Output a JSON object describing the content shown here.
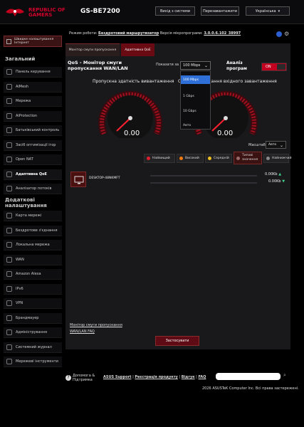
{
  "header": {
    "brand_line1": "REPUBLIC OF",
    "brand_line2": "GAMERS",
    "model": "GS-BE7200",
    "logout": "Вихід з системи",
    "reboot": "Перезавантажити",
    "language": "Українська"
  },
  "status": {
    "mode_label": "Режим роботи:",
    "mode_value": "Бездротовий маршрутизатор",
    "fw_label": "Версія мікропрограми:",
    "fw_value": "3.0.0.6.102_38997"
  },
  "sidebar": {
    "quick": "Швидке налаштування Інтернет",
    "general_title": "Загальний",
    "general_items": [
      {
        "label": "Панель керування",
        "icon": "dashboard-icon"
      },
      {
        "label": "AiMesh",
        "icon": "mesh-icon"
      },
      {
        "label": "Мережа",
        "icon": "network-icon"
      },
      {
        "label": "AiProtection",
        "icon": "shield-icon"
      },
      {
        "label": "Батьківський контроль",
        "icon": "parental-icon"
      },
      {
        "label": "Засіб оптимізації ігор",
        "icon": "gamepad-icon"
      },
      {
        "label": "Open NAT",
        "icon": "nat-icon"
      },
      {
        "label": "Адаптивна QoE",
        "icon": "qos-icon"
      },
      {
        "label": "Аналізатор потоків",
        "icon": "analyzer-icon"
      }
    ],
    "advanced_title": "Додаткові налаштування",
    "advanced_items": [
      {
        "label": "Карта мережі",
        "icon": "map-icon"
      },
      {
        "label": "Бездротове з'єднання",
        "icon": "wifi-icon"
      },
      {
        "label": "Локальна мережа",
        "icon": "lan-icon"
      },
      {
        "label": "WAN",
        "icon": "globe-icon"
      },
      {
        "label": "Amazon Alexa",
        "icon": "alexa-icon"
      },
      {
        "label": "IPv6",
        "icon": "ipv6-icon"
      },
      {
        "label": "VPN",
        "icon": "vpn-icon"
      },
      {
        "label": "Брандмауер",
        "icon": "firewall-icon"
      },
      {
        "label": "Адміністрування",
        "icon": "admin-icon"
      },
      {
        "label": "Системний журнал",
        "icon": "log-icon"
      },
      {
        "label": "Мережеві інструменти",
        "icon": "tools-icon"
      }
    ]
  },
  "main": {
    "tab1": "Монітор смуги пропускання",
    "tab2": "Адаптивна QoE",
    "title": "QoS - Монітор смуги пропускання WAN/LAN",
    "show_label": "Показати за",
    "show_value": "100 Mbps",
    "dropdown": [
      "100 Mbps",
      "1 Gbps",
      "10 Gbps",
      "Авто"
    ],
    "analysis": "Аналіз програм",
    "toggle": "ON",
    "gauge1_title": "Пропускна здатність вивантаження",
    "gauge2_title": "Смуга пропускання вхідного завантаження",
    "gauge1_value": "0.00",
    "gauge2_value": "0.00",
    "scale_label": "Масштаб",
    "scale_value": "Авто",
    "priorities": [
      {
        "label": "Найвищий",
        "color": "#e0202e"
      },
      {
        "label": "Високий",
        "color": "#f07a10"
      },
      {
        "label": "Середній",
        "color": "#f0c020"
      },
      {
        "label": "Типові значення",
        "color": "#9a6a6a"
      },
      {
        "label": "Найнижчий",
        "color": "#8a8a8a"
      }
    ],
    "device_name": "DESKTOP-48NKMFT",
    "upload_rate": "0.00Kb",
    "download_rate": "0.00Kb",
    "link1": "Монітор смуги пропускання",
    "link2": "WAN/LAN FAQ",
    "apply": "Застосувати"
  },
  "footer": {
    "help": "Допомога & Підтримка",
    "links": [
      "ASUS Support",
      "Реєстрація продукту",
      "Відгук",
      "FAQ"
    ],
    "copyright": "2026 ASUSTeK Computer Inc. Всі права застережені."
  }
}
